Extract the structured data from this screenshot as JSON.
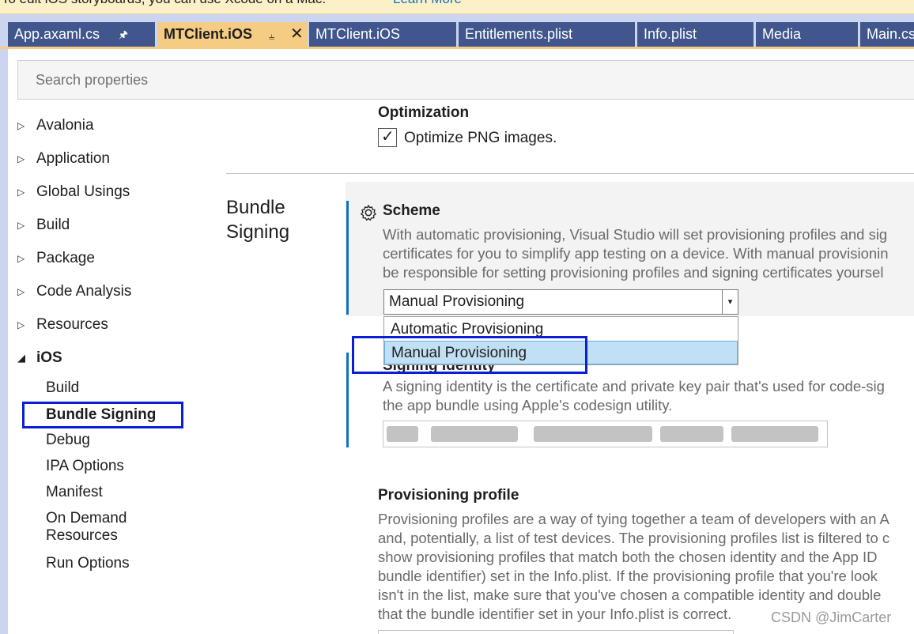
{
  "infobar": {
    "message": "To edit iOS storyboards, you can use Xcode on a Mac.",
    "link": "Learn More"
  },
  "tabs": [
    {
      "label": "App.axaml.cs",
      "pinned": true,
      "active": false
    },
    {
      "label": "MTClient.iOS",
      "pinned": true,
      "active": true
    },
    {
      "label": "MTClient.iOS",
      "active": false
    },
    {
      "label": "Entitlements.plist",
      "active": false
    },
    {
      "label": "Info.plist",
      "active": false
    },
    {
      "label": "Media",
      "active": false
    },
    {
      "label": "Main.cs",
      "active": false
    }
  ],
  "search": {
    "placeholder": "Search properties",
    "value": ""
  },
  "tree": {
    "items": [
      {
        "label": "Avalonia"
      },
      {
        "label": "Application"
      },
      {
        "label": "Global Usings"
      },
      {
        "label": "Build"
      },
      {
        "label": "Package"
      },
      {
        "label": "Code Analysis"
      },
      {
        "label": "Resources"
      },
      {
        "label": "iOS",
        "expanded": true
      }
    ],
    "ios_children": [
      {
        "label": "Build"
      },
      {
        "label": "Bundle Signing",
        "selected": true
      },
      {
        "label": "Debug"
      },
      {
        "label": "IPA Options"
      },
      {
        "label": "Manifest"
      },
      {
        "label": "On Demand"
      },
      {
        "label": "Resources"
      },
      {
        "label": "Run Options"
      }
    ]
  },
  "optimization": {
    "title": "Optimization",
    "checkbox_label": "Optimize PNG images.",
    "checked": true
  },
  "bundle_signing": {
    "group_title_line1": "Bundle",
    "group_title_line2": "Signing",
    "scheme": {
      "title": "Scheme",
      "desc_line1": "With automatic provisioning, Visual Studio will set provisioning profiles and sig",
      "desc_line2": "certificates for you to simplify app testing on a device. With manual provisionin",
      "desc_line3": "be responsible for setting provisioning profiles and signing certificates yoursel",
      "selected": "Manual Provisioning",
      "options": [
        "Automatic Provisioning",
        "Manual Provisioning"
      ]
    },
    "signing_identity": {
      "title": "Signing Identity",
      "desc_line1": "A signing identity is the certificate and private key pair that's used for code-sig",
      "desc_line2": "the app bundle using Apple's codesign utility."
    },
    "provisioning_profile": {
      "title": "Provisioning profile",
      "desc_lines": [
        "Provisioning profiles are a way of tying together a team of developers with an A",
        "and, potentially, a list of test devices. The provisioning profiles list is filtered to c",
        "show provisioning profiles that match both the chosen identity and the App ID",
        "bundle identifier) set in the Info.plist. If the provisioning profile that you're look",
        "isn't in the list, make sure that you've chosen a compatible identity and double",
        "that the bundle identifier set in your Info.plist is correct."
      ]
    }
  },
  "watermark": "CSDN @JimCarter"
}
